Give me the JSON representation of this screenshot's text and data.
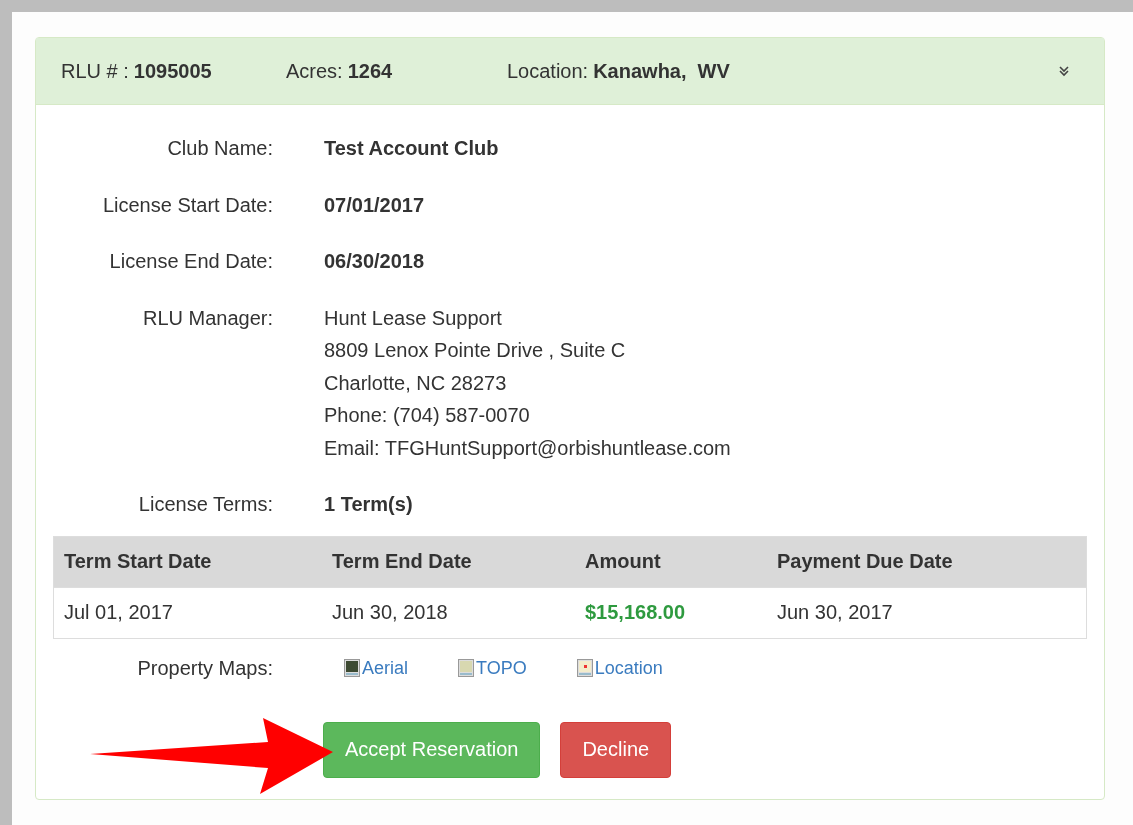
{
  "header": {
    "expanded": true,
    "fields": [
      {
        "label": "RLU # :",
        "value": "1095005"
      },
      {
        "label": "Acres:",
        "value": "1264"
      },
      {
        "label": "Location:",
        "value": "Kanawha,",
        "extra": "WV"
      }
    ]
  },
  "details": [
    {
      "label": "Club Name:",
      "lines": [
        "Test Account Club"
      ],
      "bold": true
    },
    {
      "label": "License Start Date:",
      "lines": [
        "07/01/2017"
      ],
      "bold": true
    },
    {
      "label": "License End Date:",
      "lines": [
        "06/30/2018"
      ],
      "bold": true
    },
    {
      "label": "RLU Manager:",
      "lines": [
        "Hunt Lease Support",
        "8809 Lenox Pointe Drive , Suite C",
        "Charlotte, NC 28273",
        "Phone: (704) 587-0070",
        "Email: TFGHuntSupport@orbishuntlease.com"
      ],
      "bold": false
    },
    {
      "label": "License Terms:",
      "lines": [
        "1 Term(s)"
      ],
      "bold": true
    }
  ],
  "terms_table": {
    "columns": [
      "Term Start Date",
      "Term End Date",
      "Amount",
      "Payment Due Date"
    ],
    "rows": [
      [
        "Jul 01, 2017",
        "Jun 30, 2018",
        "$15,168.00",
        "Jun 30, 2017"
      ]
    ]
  },
  "property_maps": {
    "label": "Property Maps:",
    "links": [
      {
        "kind": "aerial",
        "label": "Aerial"
      },
      {
        "kind": "topo",
        "label": "TOPO"
      },
      {
        "kind": "location",
        "label": "Location"
      }
    ]
  },
  "buttons": [
    {
      "kind": "accept",
      "label": "Accept Reservation"
    },
    {
      "kind": "decline",
      "label": "Decline"
    }
  ]
}
